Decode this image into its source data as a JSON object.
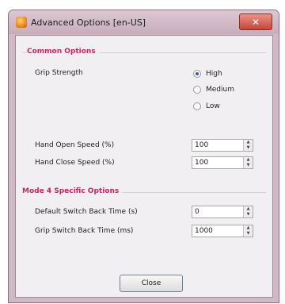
{
  "window": {
    "title": "Advanced Options [en-US]",
    "close_glyph": "✕"
  },
  "common": {
    "header": "Common Options",
    "grip_strength_label": "Grip Strength",
    "grip_options": [
      "High",
      "Medium",
      "Low"
    ],
    "grip_selected": "High",
    "hand_open_label": "Hand Open Speed (%)",
    "hand_open_value": "100",
    "hand_close_label": "Hand Close Speed (%)",
    "hand_close_value": "100"
  },
  "mode4": {
    "header": "Mode 4 Specific Options",
    "default_switch_label": "Default Switch Back Time (s)",
    "default_switch_value": "0",
    "grip_switch_label": "Grip Switch Back Time (ms)",
    "grip_switch_value": "1000"
  },
  "footer": {
    "close_label": "Close"
  },
  "icons": {
    "app": "app-logo-icon",
    "spin_up": "▲",
    "spin_down": "▼"
  }
}
